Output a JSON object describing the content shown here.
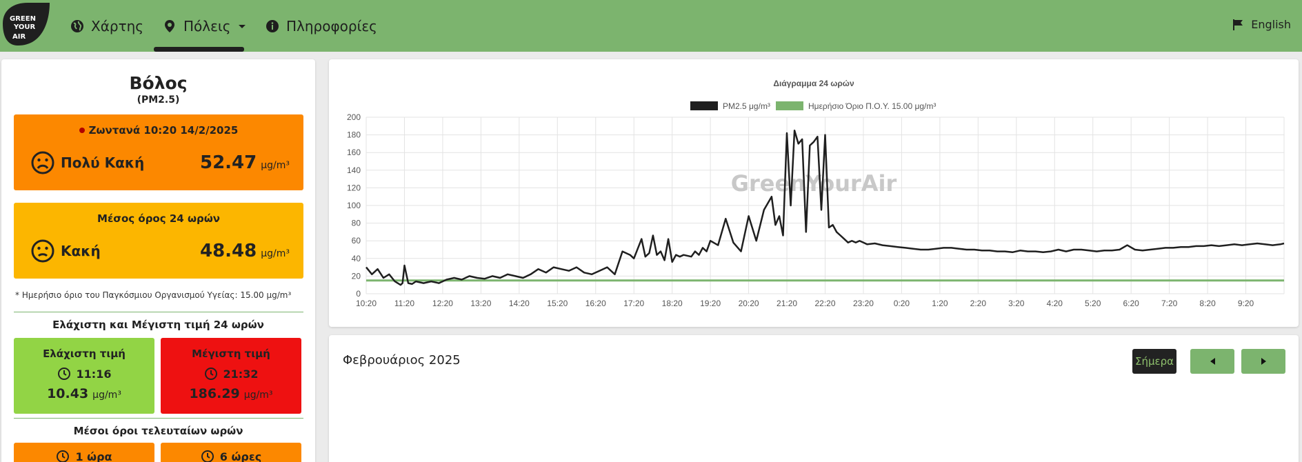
{
  "nav": {
    "logo_lines": [
      "GREEN",
      "YOUR",
      "AIR"
    ],
    "items": [
      {
        "label": "Χάρτης",
        "icon": "globe-icon"
      },
      {
        "label": "Πόλεις",
        "icon": "map-marker-icon"
      },
      {
        "label": "Πληροφορίες",
        "icon": "info-circle-icon"
      }
    ],
    "language": {
      "label": "English",
      "icon": "flag-icon"
    }
  },
  "station": {
    "city": "Βόλος",
    "pollutant": "(PM2.5)",
    "live": {
      "title": "Ζωντανά 10:20 14/2/2025",
      "status": "Πολύ Κακή",
      "value": "52.47",
      "unit": "μg/m³",
      "color": "#fc8800"
    },
    "avg24": {
      "title": "Μέσος όρος 24 ωρών",
      "status": "Κακή",
      "value": "48.48",
      "unit": "μg/m³",
      "color": "#fcb600"
    },
    "who_note": "* Ημερήσιο όριο του Παγκόσμιου Οργανισμού Υγείας: 15.00 μg/m³",
    "minmax_title": "Ελάχιστη και Μέγιστη τιμή 24 ωρών",
    "min": {
      "label": "Ελάχιστη τιμή",
      "time": "11:16",
      "value": "10.43",
      "unit": "μg/m³",
      "color": "#92d445"
    },
    "max": {
      "label": "Μέγιστη τιμή",
      "time": "21:32",
      "value": "186.29",
      "unit": "μg/m³",
      "color": "#ee1111"
    },
    "recent_title": "Μέσοι όροι τελευταίων ωρών",
    "recent": [
      {
        "label": "1 ώρα"
      },
      {
        "label": "6 ώρες"
      }
    ]
  },
  "calendar": {
    "title": "Φεβρουάριος 2025",
    "today_label": "Σήμερα"
  },
  "chart_data": {
    "type": "line",
    "title": "Διάγραμμα 24 ωρών",
    "watermark": "GreenYourAir",
    "legend": [
      {
        "name": "PM2.5 μg/m³",
        "color": "#1f1f1f"
      },
      {
        "name": "Ημερήσιο Όριο Π.Ο.Υ. 15.00 μg/m³",
        "color": "#7cb46e"
      }
    ],
    "x_ticks": [
      "10:20",
      "11:20",
      "12:20",
      "13:20",
      "14:20",
      "15:20",
      "16:20",
      "17:20",
      "18:20",
      "19:20",
      "20:20",
      "21:20",
      "22:20",
      "23:20",
      "0:20",
      "1:20",
      "2:20",
      "3:20",
      "4:20",
      "5:20",
      "6:20",
      "7:20",
      "8:20",
      "9:20"
    ],
    "y_ticks": [
      0,
      20,
      40,
      60,
      80,
      100,
      120,
      140,
      160,
      180,
      200
    ],
    "ylim": [
      0,
      200
    ],
    "x_range_hours": [
      0,
      24
    ],
    "series": [
      {
        "name": "PM2.5 μg/m³",
        "color": "#1f1f1f",
        "x_hours": [
          0,
          0.15,
          0.3,
          0.45,
          0.6,
          0.75,
          0.9,
          0.95,
          1.0,
          1.1,
          1.2,
          1.3,
          1.5,
          1.7,
          1.9,
          2.1,
          2.3,
          2.5,
          2.7,
          2.9,
          3.1,
          3.3,
          3.5,
          3.7,
          3.9,
          4.1,
          4.3,
          4.5,
          4.7,
          4.9,
          5.1,
          5.3,
          5.5,
          5.7,
          5.9,
          6.1,
          6.3,
          6.5,
          6.7,
          6.9,
          7.0,
          7.2,
          7.3,
          7.4,
          7.5,
          7.6,
          7.7,
          7.8,
          7.9,
          8.0,
          8.1,
          8.2,
          8.3,
          8.5,
          8.6,
          8.7,
          8.8,
          8.9,
          9.0,
          9.2,
          9.4,
          9.6,
          9.8,
          10.0,
          10.2,
          10.4,
          10.6,
          10.7,
          10.8,
          10.9,
          11.0,
          11.1,
          11.2,
          11.3,
          11.4,
          11.5,
          11.6,
          11.7,
          11.8,
          11.9,
          12.0,
          12.1,
          12.2,
          12.3,
          12.4,
          12.5,
          12.6,
          12.7,
          12.8,
          12.9,
          13.0,
          13.1,
          13.3,
          13.5,
          13.7,
          13.9,
          14.1,
          14.3,
          14.5,
          14.7,
          14.9,
          15.1,
          15.3,
          15.5,
          15.7,
          15.9,
          16.1,
          16.3,
          16.5,
          16.7,
          16.9,
          17.1,
          17.3,
          17.5,
          17.7,
          17.9,
          18.1,
          18.3,
          18.5,
          18.7,
          18.9,
          19.1,
          19.3,
          19.5,
          19.7,
          19.9,
          20.1,
          20.3,
          20.5,
          20.7,
          20.9,
          21.1,
          21.3,
          21.5,
          21.7,
          21.9,
          22.1,
          22.3,
          22.5,
          22.7,
          22.9,
          23.1,
          23.3,
          23.5,
          23.7,
          23.9,
          24.0
        ],
        "values": [
          30,
          22,
          28,
          18,
          22,
          14,
          10,
          12,
          32,
          12,
          11,
          14,
          12,
          14,
          12,
          16,
          18,
          16,
          20,
          18,
          17,
          20,
          18,
          22,
          20,
          18,
          22,
          28,
          24,
          30,
          28,
          26,
          30,
          24,
          22,
          26,
          30,
          22,
          48,
          44,
          40,
          62,
          42,
          46,
          66,
          44,
          48,
          38,
          62,
          36,
          44,
          42,
          44,
          42,
          48,
          44,
          52,
          48,
          60,
          55,
          85,
          58,
          48,
          88,
          60,
          95,
          110,
          78,
          88,
          66,
          182,
          100,
          185,
          170,
          175,
          70,
          168,
          172,
          178,
          95,
          180,
          75,
          78,
          70,
          66,
          62,
          58,
          60,
          58,
          60,
          58,
          56,
          57,
          55,
          54,
          53,
          52,
          51,
          50,
          50,
          51,
          52,
          52,
          51,
          50,
          50,
          49,
          49,
          48,
          48,
          47,
          49,
          48,
          48,
          47,
          48,
          50,
          48,
          50,
          50,
          49,
          48,
          49,
          49,
          50,
          55,
          50,
          49,
          50,
          51,
          52,
          52,
          53,
          53,
          54,
          54,
          55,
          54,
          55,
          56,
          55,
          56,
          57,
          56,
          55,
          56,
          57,
          58,
          55,
          52,
          50
        ]
      },
      {
        "name": "Ημερήσιο Όριο Π.Ο.Υ. 15.00 μg/m³",
        "color": "#7cb46e",
        "x_hours": [
          0,
          24
        ],
        "values": [
          15,
          15
        ]
      }
    ]
  }
}
